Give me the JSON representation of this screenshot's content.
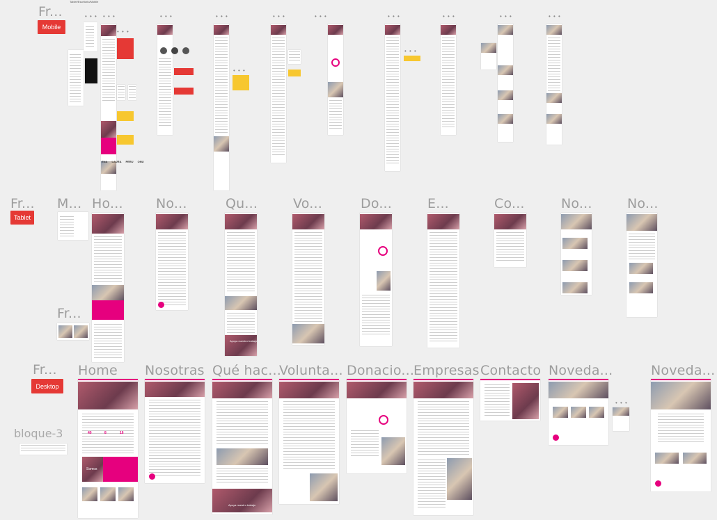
{
  "canvas": {
    "top_caption": "Fr...",
    "tiny_heading": "Tablet/Escritorio/Mobile"
  },
  "sections": [
    {
      "key": "mobile",
      "frame_title": "Fr...",
      "badge": "Mobile"
    },
    {
      "key": "tablet",
      "frame_title": "Fr...",
      "badge": "Tablet"
    },
    {
      "key": "desktop",
      "frame_title": "Fr...",
      "badge": "Desktop"
    }
  ],
  "tablet_frames": [
    "M...",
    "Ho...",
    "No...",
    "Qu...",
    "Vo...",
    "Do...",
    "E...",
    "Co...",
    "No...",
    "No..."
  ],
  "tablet_extra": "Fr...",
  "desktop_frames": [
    "Home",
    "Nosotras",
    "Qué hac...",
    "Volunta...",
    "Donacio...",
    "Empresas",
    "Contacto",
    "Noveda...",
    "Noveda..."
  ],
  "bloque": "bloque-3",
  "hero_text": {
    "tablet_donate": "Apoya nuestro trabajo",
    "desktop_donate": "Apoya nuestro trabajo",
    "somos": "Somos"
  },
  "stats": [
    "40",
    "8",
    "16"
  ],
  "logo_strip": [
    "ENA",
    "LAURA",
    "PERU",
    "ONU"
  ],
  "colors": {
    "brand": "#e6007e",
    "badge": "#e53935",
    "canvas": "#efefef",
    "note": "#f7c72f"
  }
}
